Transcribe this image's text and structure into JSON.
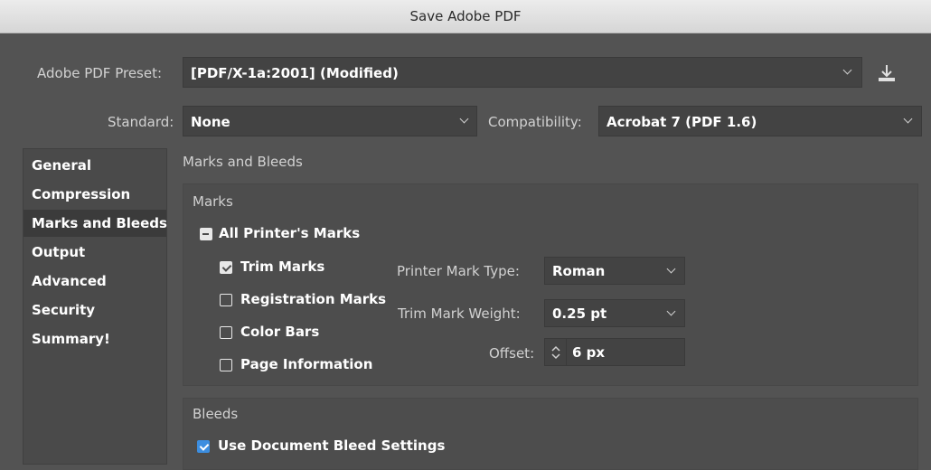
{
  "window": {
    "title": "Save Adobe PDF"
  },
  "preset": {
    "label": "Adobe PDF Preset:",
    "value": "[PDF/X-1a:2001] (Modified)"
  },
  "standard": {
    "label": "Standard:",
    "value": "None"
  },
  "compatibility": {
    "label": "Compatibility:",
    "value": "Acrobat 7 (PDF 1.6)"
  },
  "sidebar": {
    "items": [
      {
        "label": "General"
      },
      {
        "label": "Compression"
      },
      {
        "label": "Marks and Bleeds"
      },
      {
        "label": "Output"
      },
      {
        "label": "Advanced"
      },
      {
        "label": "Security"
      },
      {
        "label": "Summary!"
      }
    ],
    "selected": "Marks and Bleeds"
  },
  "panel": {
    "title": "Marks and Bleeds",
    "marks": {
      "title": "Marks",
      "all_printers_marks": "All Printer's Marks",
      "trim_marks": "Trim Marks",
      "registration_marks": "Registration Marks",
      "color_bars": "Color Bars",
      "page_information": "Page Information",
      "printer_mark_type": {
        "label": "Printer Mark Type:",
        "value": "Roman"
      },
      "trim_mark_weight": {
        "label": "Trim Mark Weight:",
        "value": "0.25 pt"
      },
      "offset": {
        "label": "Offset:",
        "value": "6 px"
      }
    },
    "bleeds": {
      "title": "Bleeds",
      "use_document_bleed": "Use Document Bleed Settings"
    }
  }
}
